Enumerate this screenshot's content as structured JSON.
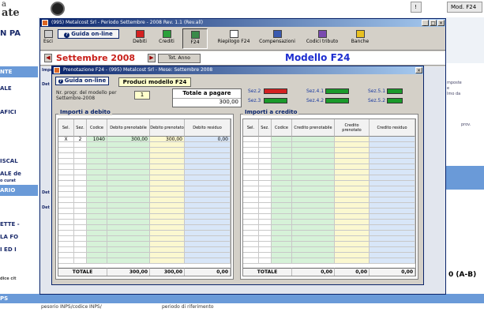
{
  "background": {
    "top_text_1": "a",
    "top_text_2": "ate",
    "top_buttons": [
      "!",
      "Mod. F24"
    ],
    "left_labels": [
      "N PA",
      "NTE",
      "ALE",
      "AFICI",
      "ISCAL",
      "ALE de",
      "o curat",
      "ARIO",
      "ETTE -",
      "LA FO",
      "I ED I",
      "dice cit",
      "PS"
    ],
    "right_texts": [
      "mposte",
      "e",
      "Imo da",
      "prov."
    ],
    "right_bottom_label": "0 (A-B)",
    "bottom_left_text": "pesorio INPS/codice INPS/",
    "bottom_mid_text": "periodo di riferimento"
  },
  "main_window": {
    "title": "(995) Metalcost Srl - Periodo Settembre - 2008 Rev. 1.1 (Rev.all)",
    "toolbar": {
      "guida": "Guida on-line",
      "buttons": [
        {
          "label": "Esci",
          "icon": "exit-icon"
        },
        {
          "label": "Debiti",
          "icon": "debit-icon"
        },
        {
          "label": "Crediti",
          "icon": "credit-icon"
        },
        {
          "label": "F24",
          "icon": "f24-icon"
        },
        {
          "label": "Riepilogo F24",
          "icon": "summary-icon"
        },
        {
          "label": "Compensazioni",
          "icon": "compensation-icon"
        },
        {
          "label": "Codici tributo",
          "icon": "codes-icon"
        },
        {
          "label": "Banche",
          "icon": "bank-icon"
        }
      ]
    },
    "month": "Settembre 2008",
    "tot_anno": "Tot. Anno",
    "modello": "Modello F24",
    "side_tabs": [
      "Impo",
      "Det",
      "Det",
      "Det"
    ]
  },
  "dialog": {
    "title": "Prenotazione F24 - (995) Metalcost Srl - Mese: Settembre 2008",
    "guida": "Guida on-line",
    "produci": "Produci modello F24",
    "nr_progr_label": "Nr. progr. del modello per Settembre-2008",
    "nr_progr_value": "1",
    "totale_label": "Totale a pagare",
    "totale_value": "300,00",
    "sections": [
      {
        "label": "Sez.2",
        "color": "#d42020"
      },
      {
        "label": "Sez.4.1",
        "color": "#1a9a2a"
      },
      {
        "label": "Sez.5.1",
        "color": "#1a9a2a"
      },
      {
        "label": "Sez.3",
        "color": "#1a9a2a"
      },
      {
        "label": "Sez.4.2",
        "color": "#1a9a2a"
      },
      {
        "label": "Sez.5.2",
        "color": "#1a9a2a"
      }
    ],
    "debit_table": {
      "title": "Importi a debito",
      "columns": [
        "Sel.",
        "Sez.",
        "Codice",
        "Debito prenotabile",
        "Debito prenotato",
        "Debito residuo"
      ],
      "rows": [
        {
          "sel": "X",
          "sez": "2",
          "codice": "1040",
          "prenotabile": "300,00",
          "prenotato": "300,00",
          "residuo": "0,00"
        }
      ],
      "total_label": "TOTALE",
      "total_values": [
        "300,00",
        "300,00",
        "0,00"
      ]
    },
    "credit_table": {
      "title": "Importi a credito",
      "columns": [
        "Sel.",
        "Sez.",
        "Codice",
        "Credito prenotabile",
        "Credito prenotato",
        "Credito residuo"
      ],
      "rows": [],
      "total_label": "TOTALE",
      "total_values": [
        "0,00",
        "0,00",
        "0,00"
      ]
    }
  }
}
